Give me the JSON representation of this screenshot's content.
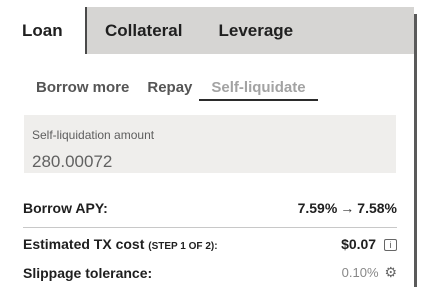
{
  "tabs": [
    {
      "label": "Loan",
      "active": true
    },
    {
      "label": "Collateral",
      "active": false
    },
    {
      "label": "Leverage",
      "active": false
    }
  ],
  "subtabs": [
    {
      "label": "Borrow more",
      "active": false
    },
    {
      "label": "Repay",
      "active": false
    },
    {
      "label": "Self-liquidate",
      "active": true
    }
  ],
  "amount": {
    "label": "Self-liquidation amount",
    "value": "280.00072"
  },
  "borrow_apy": {
    "label": "Borrow APY:",
    "from": "7.59%",
    "arrow": "→",
    "to": "7.58%"
  },
  "tx_cost": {
    "label": "Estimated TX cost",
    "step": "(STEP 1 OF 2):",
    "value": "$0.07"
  },
  "slippage": {
    "label": "Slippage tolerance:",
    "value": "0.10%"
  },
  "icons": {
    "info": "info-icon",
    "settings": "gear-icon"
  }
}
